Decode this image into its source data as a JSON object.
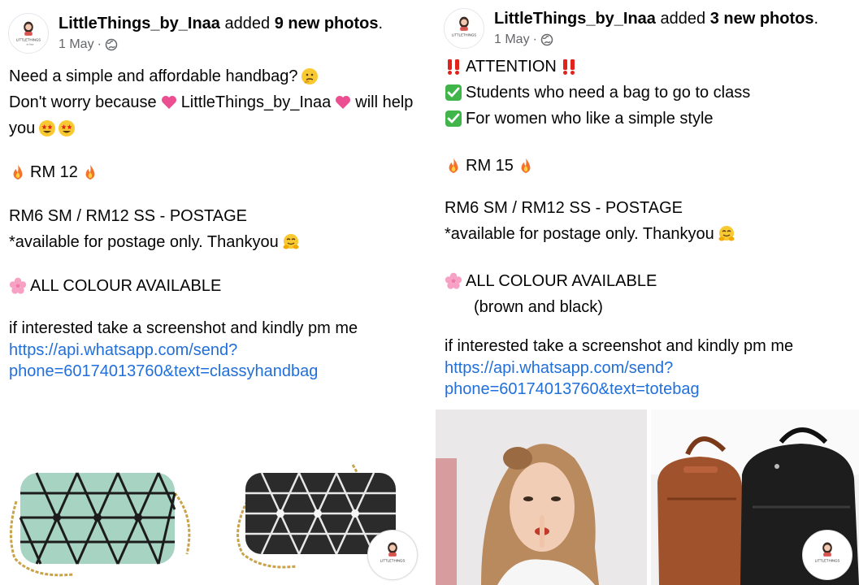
{
  "posts": [
    {
      "author": "LittleThings_by_Inaa",
      "action_prefix": "added",
      "action_count": "9 new photos",
      "action_suffix": ".",
      "date": "1 May",
      "date_sep": "·",
      "avatar_text": "LITTLETHINGS",
      "lines": {
        "l1": "Need a simple and affordable handbag?",
        "l2a": "Don't worry because",
        "l2b": "LittleThings_by_Inaa",
        "l2c": "will help",
        "l3": "you",
        "price": "RM 12",
        "postage": "RM6 SM / RM12 SS - POSTAGE",
        "avail": "*available for postage only. Thankyou",
        "colour": "ALL COLOUR AVAILABLE",
        "interest": "if interested take a screenshot and kindly pm me",
        "link1": "https://api.whatsapp.com/send?",
        "link2": "phone=60174013760&text=classyhandbag"
      },
      "photos": [
        "mint-geometric-crossbody-bag",
        "black-geometric-crossbody-bag"
      ]
    },
    {
      "author": "LittleThings_by_Inaa",
      "action_prefix": "added",
      "action_count": "3 new photos",
      "action_suffix": ".",
      "date": "1 May",
      "date_sep": "·",
      "avatar_text": "LITTLETHINGS",
      "lines": {
        "attention": "ATTENTION",
        "check1": "Students who need a bag to go to class",
        "check2": "For women who like a simple style",
        "price": "RM 15",
        "postage": "RM6 SM / RM12 SS - POSTAGE",
        "avail": "*available for postage only. Thankyou",
        "colour": "ALL COLOUR AVAILABLE",
        "colour_detail": "(brown and black)",
        "interest": "if interested take a screenshot and kindly pm me",
        "link1": "https://api.whatsapp.com/send?",
        "link2": "phone=60174013760&text=totebag"
      },
      "photos": [
        "woman-model-photo",
        "brown-and-black-backpacks"
      ]
    }
  ],
  "colors": {
    "text": "#050505",
    "meta": "#65676b",
    "link": "#216fdb",
    "attention_red": "#e0241b",
    "check_green": "#3fb54a"
  },
  "icons": [
    "globe-icon",
    "thinking-face-icon",
    "pink-heart-icon",
    "star-struck-icon",
    "fire-icon",
    "hugging-face-icon",
    "cherry-blossom-icon",
    "double-exclamation-icon",
    "check-mark-icon"
  ]
}
